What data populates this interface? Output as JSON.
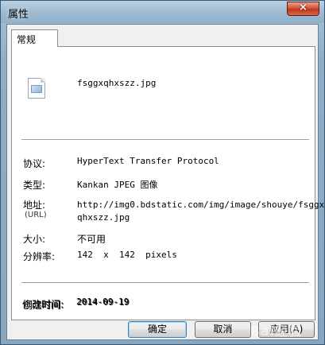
{
  "window": {
    "title": "属性",
    "close_icon": "×"
  },
  "tabs": [
    {
      "label": "常规",
      "active": true
    }
  ],
  "file": {
    "icon": "jpeg-image-file-icon",
    "name": "fsggxqhxszz.jpg"
  },
  "properties": {
    "protocol": {
      "label": "协议:",
      "value": "HyperText Transfer Protocol"
    },
    "type": {
      "label": "类型:",
      "value": "Kankan JPEG 图像"
    },
    "address": {
      "label": "地址:",
      "sublabel": "(URL)",
      "value_line1": "http://img0.bdstatic.com/img/image/shouye/fsggx",
      "value_line2": "qhxszz.jpg"
    },
    "size": {
      "label": "大小:",
      "value": "不可用"
    },
    "dimensions": {
      "label": "分辨率:",
      "value": "142  x  142  pixels"
    },
    "created": {
      "label": "创建时间:",
      "value": "2014-09-19"
    },
    "modified": {
      "label": "修改时间:",
      "value": "2014-09-19"
    }
  },
  "buttons": {
    "ok": "确定",
    "cancel": "取消",
    "apply": "应用(A)"
  },
  "watermark": "Bai经验"
}
